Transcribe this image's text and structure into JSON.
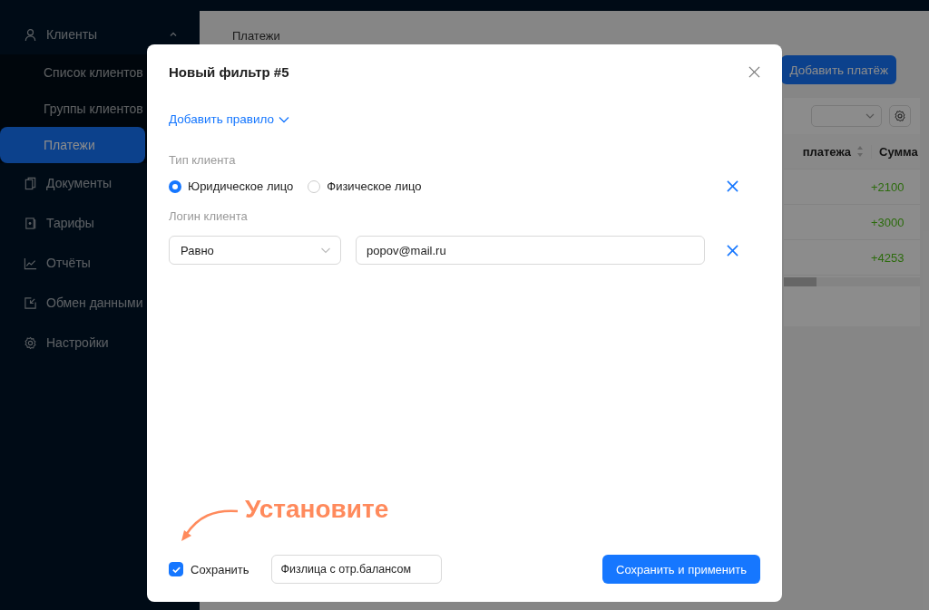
{
  "sidebar": {
    "items": [
      {
        "label": "Клиенты",
        "expanded": true,
        "selected": false,
        "children": [
          {
            "label": "Список клиентов",
            "selected": false
          },
          {
            "label": "Группы клиентов",
            "selected": false
          },
          {
            "label": "Платежи",
            "selected": true
          }
        ]
      },
      {
        "label": "Документы",
        "selected": false
      },
      {
        "label": "Тарифы",
        "selected": false
      },
      {
        "label": "Отчёты",
        "selected": false
      },
      {
        "label": "Обмен данными",
        "selected": false
      },
      {
        "label": "Настройки",
        "selected": false
      }
    ]
  },
  "page": {
    "breadcrumb": "Платежи",
    "add_button": "Добавить платёж",
    "table": {
      "columns": [
        "платежа",
        "Сумма"
      ],
      "rows": [
        {
          "amount": "+2100"
        },
        {
          "amount": "+3000"
        },
        {
          "amount": "+4253"
        }
      ]
    }
  },
  "dialog": {
    "title": "Новый фильтр #5",
    "add_rule": "Добавить правило",
    "rules": [
      {
        "kind": "radio",
        "label": "Тип клиента",
        "options": [
          {
            "label": "Юридическое лицо",
            "selected": true
          },
          {
            "label": "Физическое лицо",
            "selected": false
          }
        ]
      },
      {
        "kind": "text",
        "label": "Логин клиента",
        "operator": "Равно",
        "value": "popov@mail.ru"
      }
    ],
    "save": {
      "label": "Сохранить",
      "checked": true
    },
    "filter_name": "Физлица с отр.балансом",
    "apply_button": "Сохранить и применить"
  },
  "annotation": {
    "text": "Установите"
  }
}
